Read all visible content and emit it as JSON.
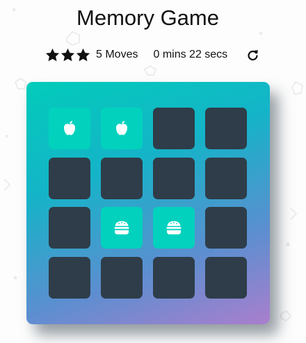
{
  "game": {
    "title": "Memory Game"
  },
  "score_panel": {
    "stars_filled": 3,
    "stars_total": 3,
    "moves": "5 Moves",
    "timer": "0 mins 22 secs",
    "restart_icon": "restart-icon"
  },
  "deck": {
    "rows": 4,
    "cols": 4,
    "cards": [
      {
        "state": "match",
        "icon": "apple-icon"
      },
      {
        "state": "match",
        "icon": "apple-icon"
      },
      {
        "state": "hidden",
        "icon": ""
      },
      {
        "state": "hidden",
        "icon": ""
      },
      {
        "state": "hidden",
        "icon": ""
      },
      {
        "state": "hidden",
        "icon": ""
      },
      {
        "state": "hidden",
        "icon": ""
      },
      {
        "state": "hidden",
        "icon": ""
      },
      {
        "state": "hidden",
        "icon": ""
      },
      {
        "state": "match",
        "icon": "burger-icon"
      },
      {
        "state": "match",
        "icon": "burger-icon"
      },
      {
        "state": "hidden",
        "icon": ""
      },
      {
        "state": "hidden",
        "icon": ""
      },
      {
        "state": "hidden",
        "icon": ""
      },
      {
        "state": "hidden",
        "icon": ""
      },
      {
        "state": "hidden",
        "icon": ""
      }
    ]
  },
  "colors": {
    "card_hidden": "#2e3d49",
    "card_match": "#02d1bd",
    "deck_gradient_start": "#02ccba",
    "deck_gradient_end": "#aa7ecd"
  }
}
